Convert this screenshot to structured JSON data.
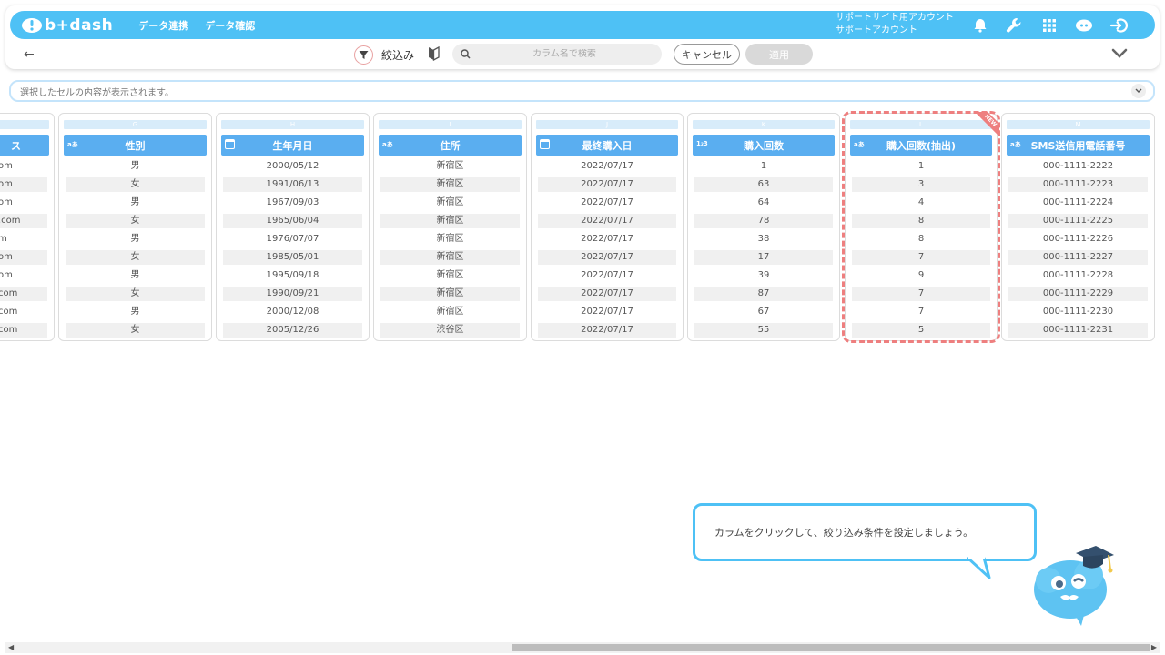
{
  "header": {
    "logo_text": "b+dash",
    "nav": [
      "データ連携",
      "データ確認"
    ],
    "account_line1": "サポートサイト用アカウント",
    "account_line2": "サポートアカウント",
    "accent_color": "#4ec1f5"
  },
  "toolbar": {
    "filter_label": "絞込み",
    "search_placeholder": "カラム名で検索",
    "cancel_label": "キャンセル",
    "apply_label": "適用"
  },
  "cell_bar": {
    "placeholder": "選択したセルの内容が表示されます。"
  },
  "columns": [
    {
      "letter": "",
      "title": "ス",
      "type": "text",
      "values": [
        "om",
        "om",
        "om",
        ".com",
        "m",
        "om",
        "om",
        "com",
        "com",
        "com"
      ]
    },
    {
      "letter": "G",
      "title": "性別",
      "type": "text",
      "values": [
        "男",
        "女",
        "男",
        "女",
        "男",
        "女",
        "男",
        "女",
        "男",
        "女"
      ]
    },
    {
      "letter": "H",
      "title": "生年月日",
      "type": "date",
      "values": [
        "2000/05/12",
        "1991/06/13",
        "1967/09/03",
        "1965/06/04",
        "1976/07/07",
        "1985/05/01",
        "1995/09/18",
        "1990/09/21",
        "2000/12/08",
        "2005/12/26"
      ]
    },
    {
      "letter": "I",
      "title": "住所",
      "type": "text",
      "values": [
        "新宿区",
        "新宿区",
        "新宿区",
        "新宿区",
        "新宿区",
        "新宿区",
        "新宿区",
        "新宿区",
        "新宿区",
        "渋谷区"
      ]
    },
    {
      "letter": "J",
      "title": "最終購入日",
      "type": "date",
      "values": [
        "2022/07/17",
        "2022/07/17",
        "2022/07/17",
        "2022/07/17",
        "2022/07/17",
        "2022/07/17",
        "2022/07/17",
        "2022/07/17",
        "2022/07/17",
        "2022/07/17"
      ]
    },
    {
      "letter": "K",
      "title": "購入回数",
      "type": "number",
      "values": [
        "1",
        "63",
        "64",
        "78",
        "38",
        "17",
        "39",
        "87",
        "67",
        "55"
      ]
    },
    {
      "letter": "L",
      "title": "購入回数(抽出)",
      "type": "text",
      "values": [
        "1",
        "3",
        "4",
        "8",
        "8",
        "7",
        "9",
        "7",
        "7",
        "5"
      ]
    },
    {
      "letter": "M",
      "title": "SMS送信用電話番号",
      "type": "text",
      "values": [
        "000-1111-2222",
        "000-1111-2223",
        "000-1111-2224",
        "000-1111-2225",
        "000-1111-2226",
        "000-1111-2227",
        "000-1111-2228",
        "000-1111-2229",
        "000-1111-2230",
        "000-1111-2231"
      ]
    }
  ],
  "new_badge": "NEW",
  "type_icons": {
    "text": "aあ",
    "number": "1₂3"
  },
  "hint": {
    "message": "カラムをクリックして、絞り込み条件を設定しましょう。"
  }
}
